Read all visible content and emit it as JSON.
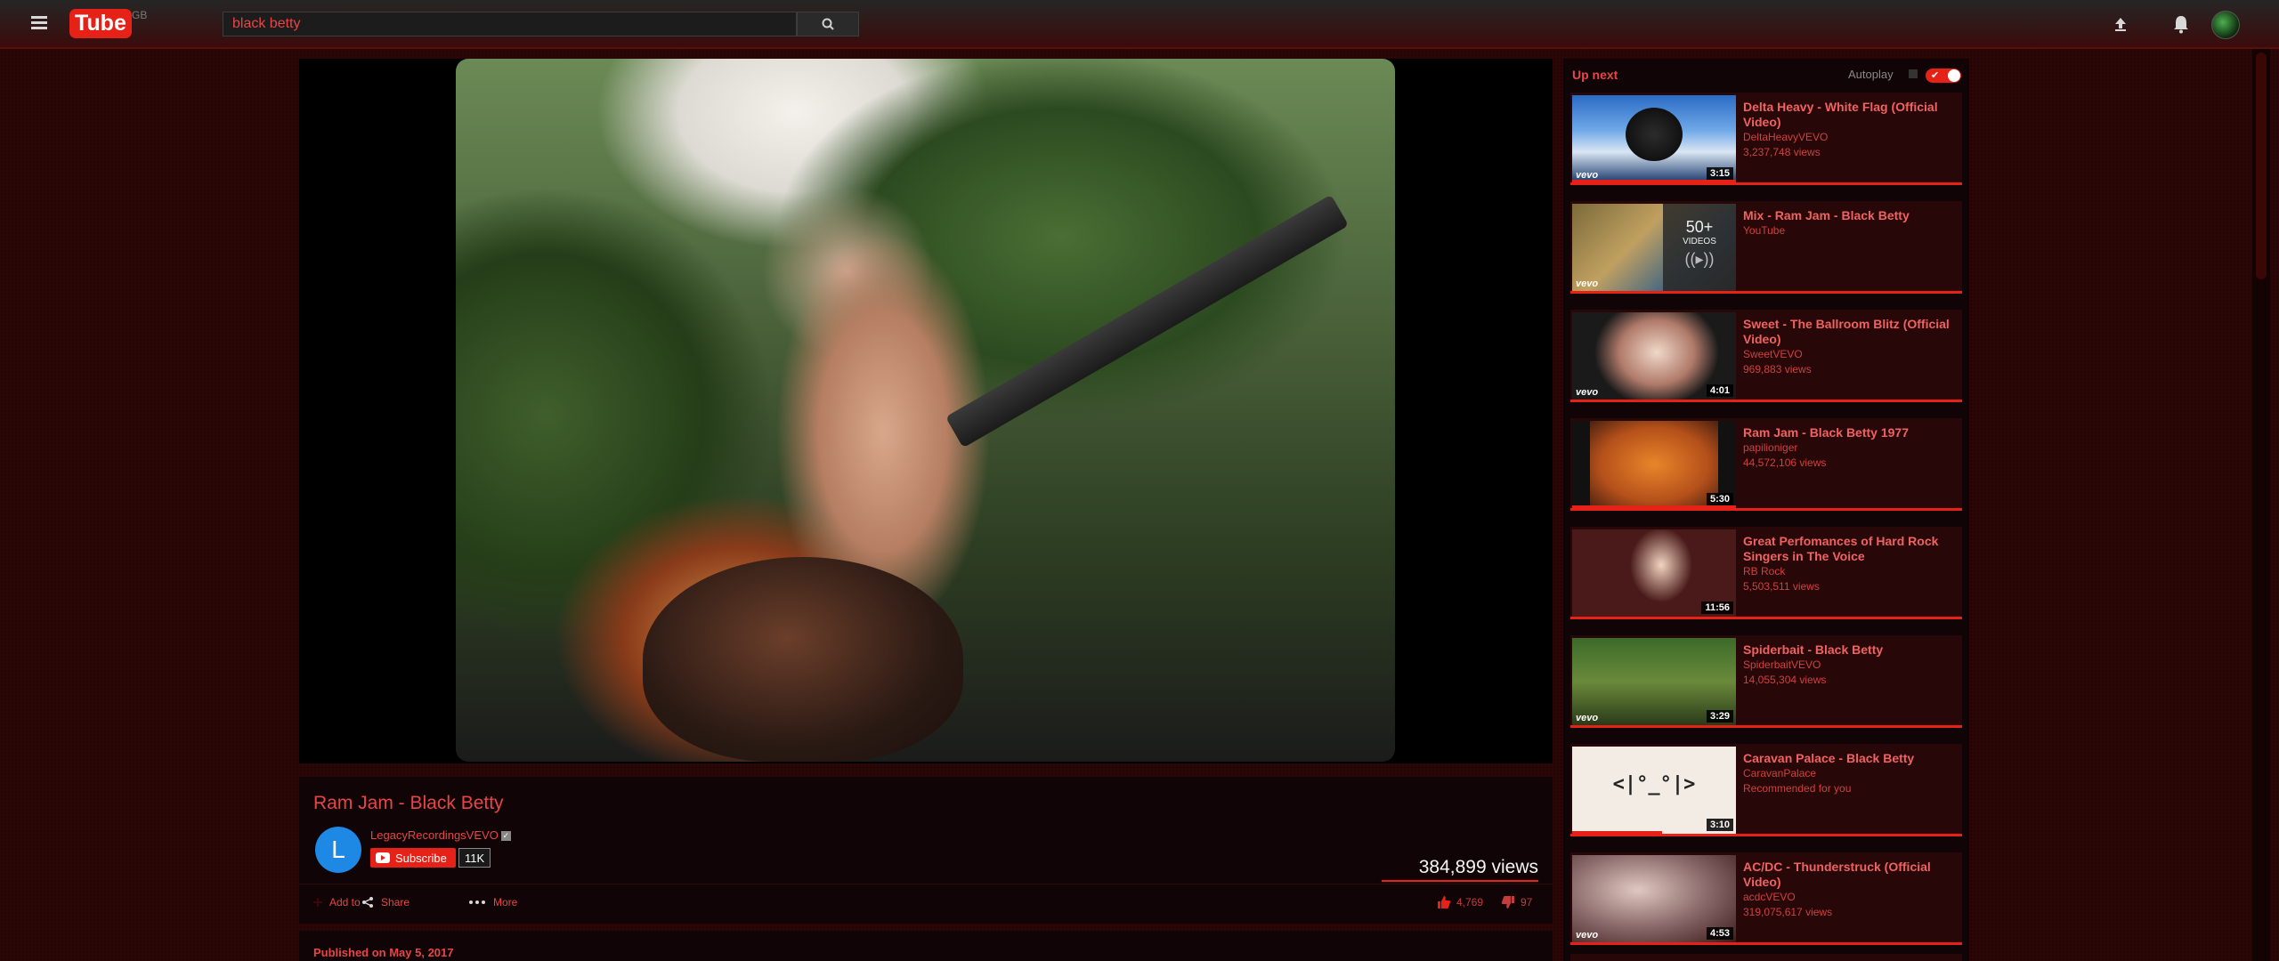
{
  "header": {
    "logo_you": "You",
    "logo_tube": "Tube",
    "country_code": "GB",
    "search_value": "black betty",
    "icons": [
      "menu-icon",
      "search-icon",
      "upload-icon",
      "bell-icon",
      "avatar"
    ]
  },
  "video": {
    "title": "Ram Jam - Black Betty",
    "channel_initial": "L",
    "channel": "LegacyRecordingsVEVO",
    "subscribe_label": "Subscribe",
    "subscriber_count": "11K",
    "views": "384,899 views",
    "actions": {
      "add_to": "Add to",
      "share": "Share",
      "more": "More"
    },
    "likes": "4,769",
    "dislikes": "97",
    "published": "Published on May 5, 2017"
  },
  "sidebar": {
    "up_next": "Up next",
    "autoplay_label": "Autoplay",
    "autoplay_on": true,
    "items": [
      {
        "title": "Delta Heavy - White Flag (Official Video)",
        "channel": "DeltaHeavyVEVO",
        "views": "3,237,748 views",
        "duration": "3:15",
        "vevo": "vevo",
        "progress": 1.0
      },
      {
        "title": "Mix - Ram Jam - Black Betty",
        "channel": "YouTube",
        "views": "",
        "duration": "",
        "vevo": "vevo",
        "mix_count": "50+",
        "mix_label": "VIDEOS",
        "progress": 0
      },
      {
        "title": "Sweet - The Ballroom Blitz (Official Video)",
        "channel": "SweetVEVO",
        "views": "969,883 views",
        "duration": "4:01",
        "vevo": "vevo",
        "progress": 0
      },
      {
        "title": "Ram Jam - Black Betty 1977",
        "channel": "papilioniger",
        "views": "44,572,106 views",
        "duration": "5:30",
        "vevo": "",
        "progress": 1.0
      },
      {
        "title": "Great Perfomances of Hard Rock Singers in The Voice",
        "channel": "RB Rock",
        "views": "5,503,511 views",
        "duration": "11:56",
        "vevo": "",
        "progress": 0
      },
      {
        "title": "Spiderbait - Black Betty",
        "channel": "SpiderbaitVEVO",
        "views": "14,055,304 views",
        "duration": "3:29",
        "vevo": "vevo",
        "progress": 0
      },
      {
        "title": "Caravan Palace - Black Betty",
        "channel": "CaravanPalace",
        "views": "Recommended for you",
        "duration": "3:10",
        "vevo": "",
        "thumb_text": "<|°_°|>",
        "progress": 0.55
      },
      {
        "title": "AC/DC - Thunderstruck (Official Video)",
        "channel": "acdcVEVO",
        "views": "319,075,617 views",
        "duration": "4:53",
        "vevo": "vevo",
        "progress": 0
      }
    ]
  },
  "colors": {
    "accent": "#e62117",
    "text": "#e84545",
    "background": "#2a0606"
  }
}
